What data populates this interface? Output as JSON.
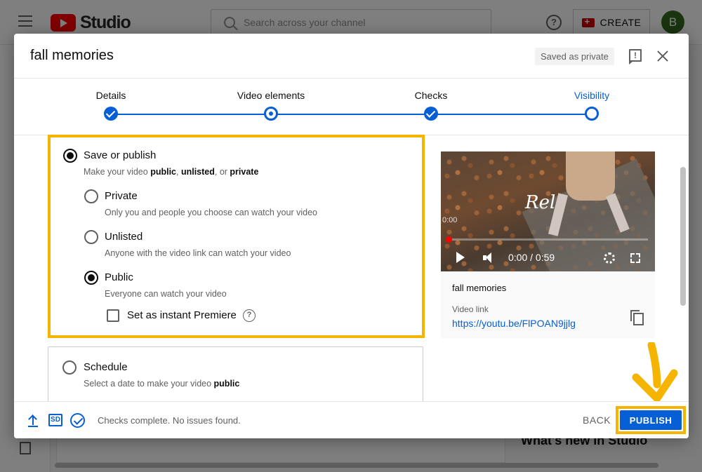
{
  "background": {
    "logo_text": "Studio",
    "search_placeholder": "Search across your channel",
    "help_icon": "?",
    "create_label": "CREATE",
    "avatar_letter": "B",
    "whats_new": "What's new in Studio"
  },
  "dialog": {
    "title": "fall memories",
    "saved_status": "Saved as private",
    "feedback_icon": "!",
    "steps": [
      {
        "label": "Details",
        "state": "done"
      },
      {
        "label": "Video elements",
        "state": "done"
      },
      {
        "label": "Checks",
        "state": "done"
      },
      {
        "label": "Visibility",
        "state": "current"
      }
    ],
    "save_publish": {
      "title": "Save or publish",
      "desc_pre": "Make your video ",
      "desc_public": "public",
      "desc_sep1": ", ",
      "desc_unlisted": "unlisted",
      "desc_sep2": ", or ",
      "desc_private": "private",
      "options": [
        {
          "title": "Private",
          "desc": "Only you and people you choose can watch your video",
          "selected": false
        },
        {
          "title": "Unlisted",
          "desc": "Anyone with the video link can watch your video",
          "selected": false
        },
        {
          "title": "Public",
          "desc": "Everyone can watch your video",
          "selected": true
        }
      ],
      "premiere_label": "Set as instant Premiere",
      "premiere_help": "?"
    },
    "schedule": {
      "title": "Schedule",
      "desc_pre": "Select a date to make your video ",
      "desc_bold": "public"
    },
    "preview": {
      "overlay_text": "Rel",
      "ghost_time": "0:00",
      "time": "0:00 / 0:59",
      "video_title": "fall memories",
      "link_label": "Video link",
      "link": "https://youtu.be/FlPOAN9jjlg"
    },
    "footer": {
      "sd_label": "SD",
      "checks_text": "Checks complete. No issues found.",
      "back_label": "BACK",
      "publish_label": "PUBLISH"
    }
  },
  "colors": {
    "accent_blue": "#065fd4",
    "highlight_yellow": "#f5b400",
    "brand_red": "#ff0000"
  }
}
